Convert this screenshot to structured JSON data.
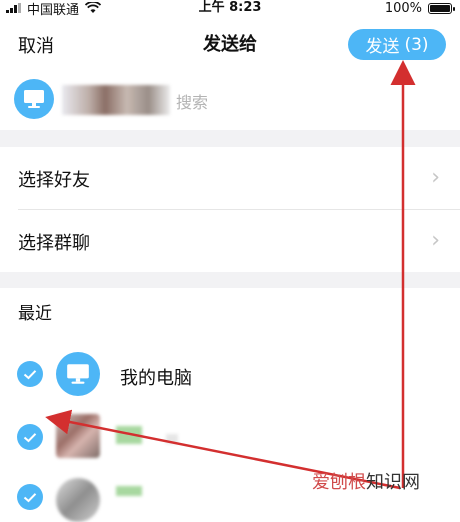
{
  "status_bar": {
    "carrier": "中国联通",
    "time": "上午 8:23",
    "battery": "100%"
  },
  "nav": {
    "cancel": "取消",
    "title": "发送给",
    "send_label": "发送",
    "send_count": "(3)"
  },
  "search": {
    "placeholder_tail": "搜索"
  },
  "menu": {
    "select_friends": "选择好友",
    "select_groups": "选择群聊"
  },
  "recent": {
    "title": "最近",
    "items": [
      {
        "name": "我的电脑",
        "checked": true
      },
      {
        "name": "",
        "checked": true
      },
      {
        "name": "",
        "checked": true
      }
    ]
  },
  "watermark": {
    "brand": "爱刨根",
    "suffix": "知识网"
  },
  "colors": {
    "accent": "#4db6f6",
    "arrow": "#d32f2f",
    "section_bg": "#f2f2f4"
  }
}
